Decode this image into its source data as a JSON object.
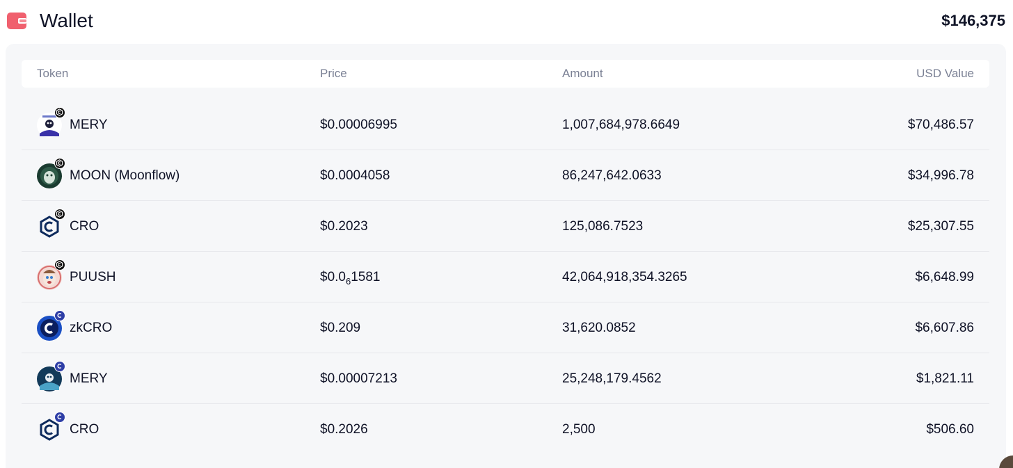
{
  "header": {
    "title": "Wallet",
    "total": "$146,375",
    "icon": "wallet-icon",
    "icon_color": "#f0606e"
  },
  "table": {
    "columns": {
      "token": "Token",
      "price": "Price",
      "amount": "Amount",
      "usd_value": "USD Value"
    },
    "rows": [
      {
        "name": "MERY",
        "price": "$0.00006995",
        "amount": "1,007,684,978.6649",
        "usd": "$70,486.57",
        "logo": "mery-logo",
        "chain": "cronos"
      },
      {
        "name": "MOON (Moonflow)",
        "price": "$0.0004058",
        "amount": "86,247,642.0633",
        "usd": "$34,996.78",
        "logo": "moon-logo",
        "chain": "cronos"
      },
      {
        "name": "CRO",
        "price": "$0.2023",
        "amount": "125,086.7523",
        "usd": "$25,307.55",
        "logo": "cro-logo",
        "chain": "cronos"
      },
      {
        "name": "PUUSH",
        "price_prefix": "$0.0",
        "price_sub": "6",
        "price_suffix": "1581",
        "amount": "42,064,918,354.3265",
        "usd": "$6,648.99",
        "logo": "puush-logo",
        "chain": "cronos"
      },
      {
        "name": "zkCRO",
        "price": "$0.209",
        "amount": "31,620.0852",
        "usd": "$6,607.86",
        "logo": "zkcro-logo",
        "chain": "cronos-zkevm"
      },
      {
        "name": "MERY",
        "price": "$0.00007213",
        "amount": "25,248,179.4562",
        "usd": "$1,821.11",
        "logo": "mery-logo",
        "chain": "cronos-zkevm"
      },
      {
        "name": "CRO",
        "price": "$0.2026",
        "amount": "2,500",
        "usd": "$506.60",
        "logo": "cro-logo",
        "chain": "cronos-zkevm"
      }
    ]
  }
}
